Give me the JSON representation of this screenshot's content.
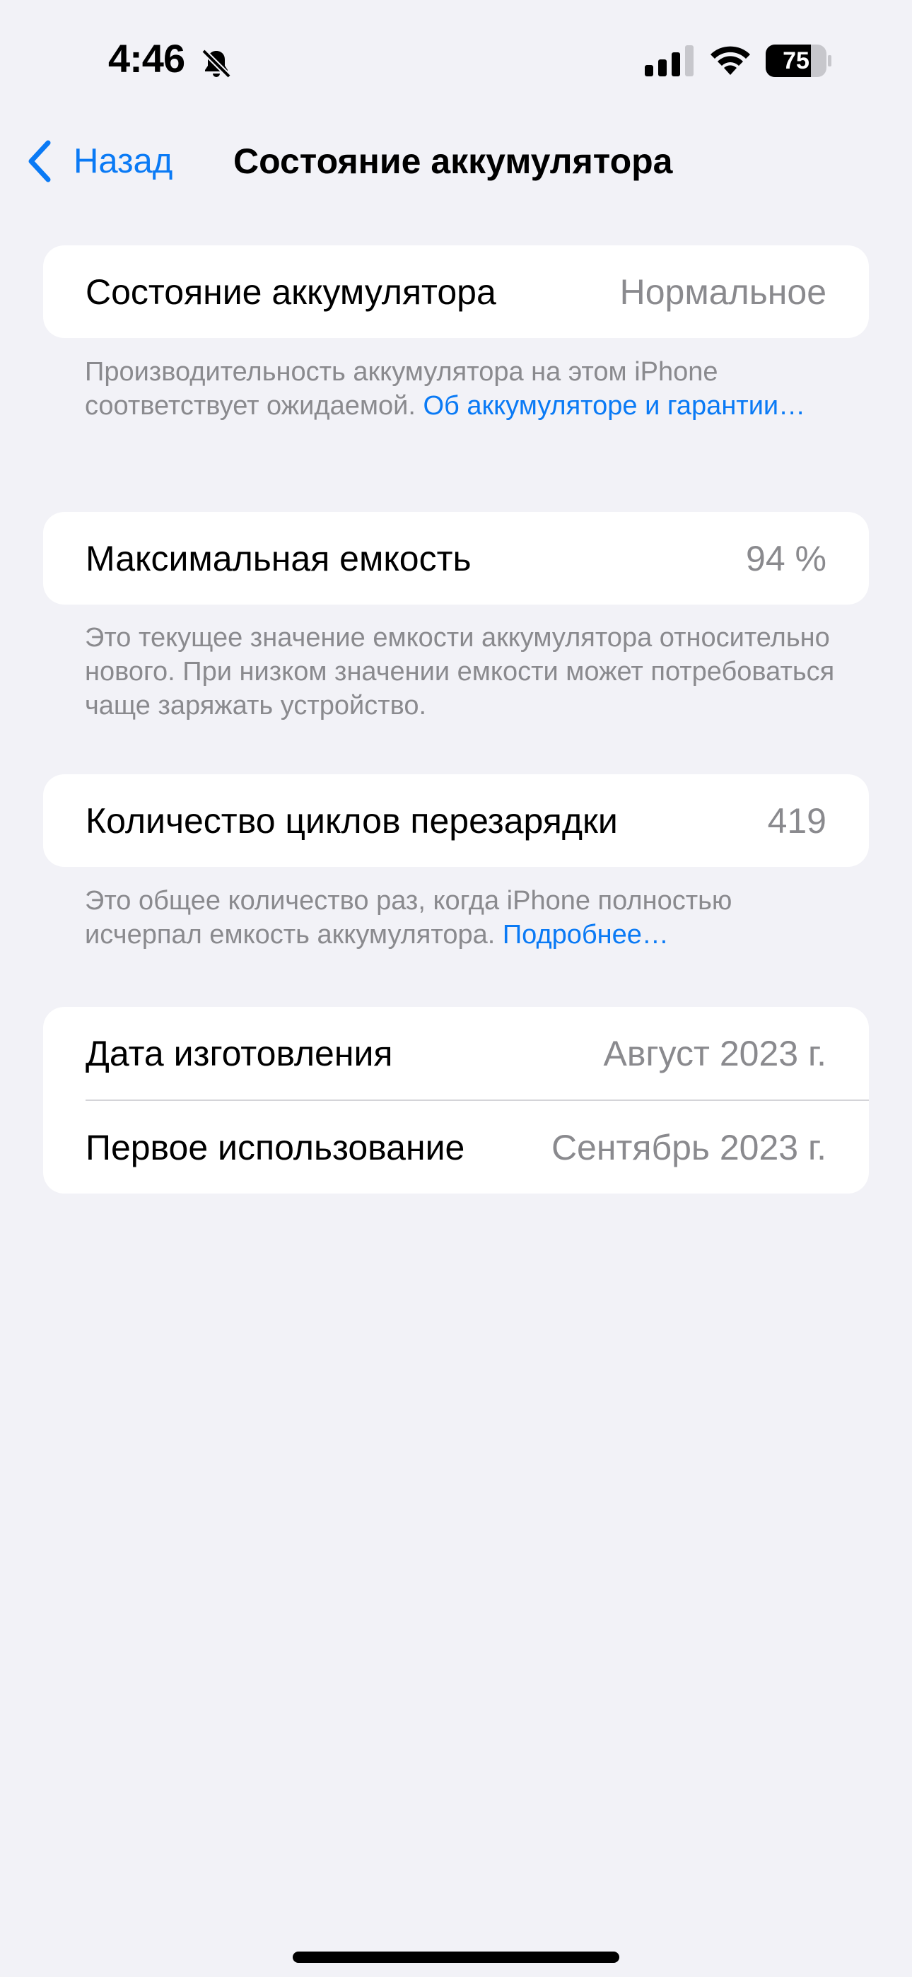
{
  "status_bar": {
    "time": "4:46",
    "battery_level": "75",
    "icons": [
      "bell-slash-icon",
      "cellular-signal-icon",
      "wifi-icon",
      "battery-icon"
    ]
  },
  "nav": {
    "back_label": "Назад",
    "title": "Состояние аккумулятора",
    "back_icon": "chevron-left-icon"
  },
  "battery_health": {
    "label": "Состояние аккумулятора",
    "value": "Нормальное",
    "note_text": "Производительность аккумулятора на этом iPhone соответствует ожидаемой. ",
    "note_link": "Об аккумуляторе и гарантии…"
  },
  "max_capacity": {
    "label": "Максимальная емкость",
    "value": "94 %",
    "note_text": "Это текущее значение емкости аккумулятора относительно нового. При низком значении емкости может потребоваться чаще заряжать устройство."
  },
  "cycle_count": {
    "label": "Количество циклов перезарядки",
    "value": "419",
    "note_text": "Это общее количество раз, когда iPhone полностью исчерпал емкость аккумулятора. ",
    "note_link": "Подробнее…"
  },
  "dates": {
    "manufacture_label": "Дата изготовления",
    "manufacture_value": "Август 2023 г.",
    "first_use_label": "Первое использование",
    "first_use_value": "Сентябрь 2023 г."
  },
  "colors": {
    "accent": "#0a7af5",
    "background": "#f2f2f7",
    "secondary_text": "#8a8a8e"
  }
}
